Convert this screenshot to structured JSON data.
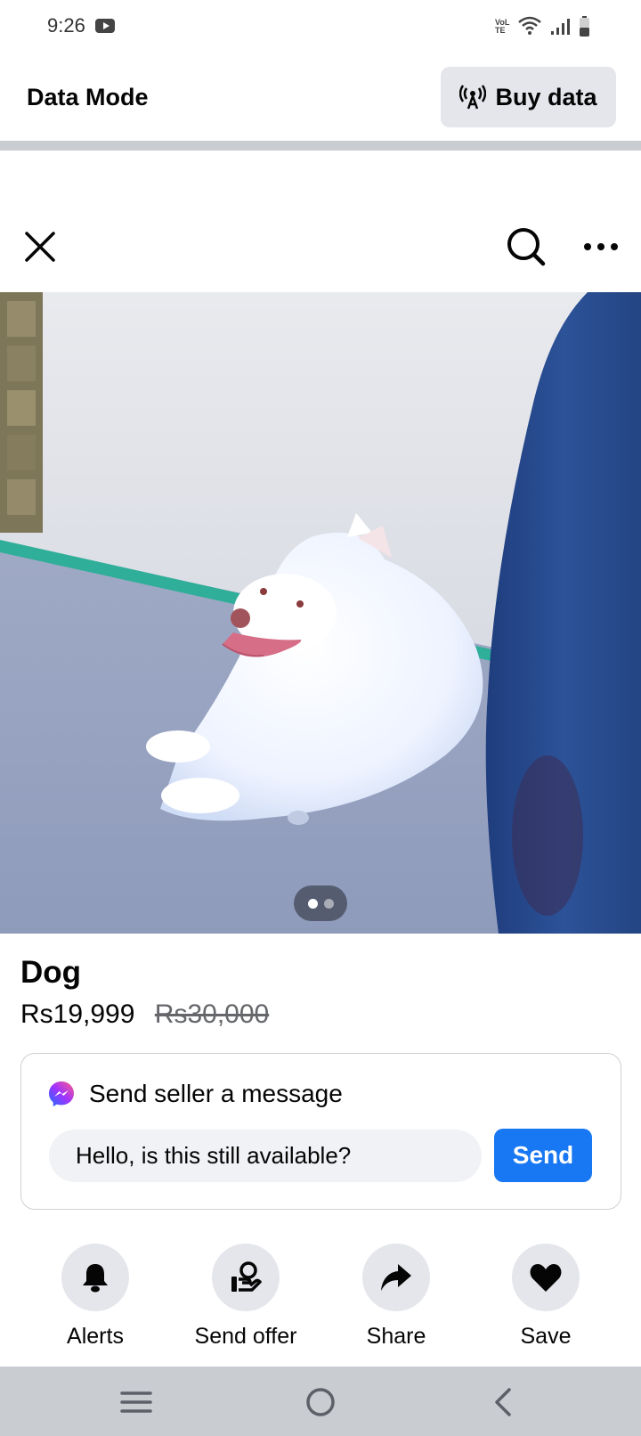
{
  "status_bar": {
    "time": "9:26",
    "network_label": "VoLTE"
  },
  "data_mode": {
    "label": "Data Mode",
    "buy_label": "Buy data"
  },
  "listing": {
    "title": "Dog",
    "price": "Rs19,999",
    "original_price": "Rs30,000",
    "photo_index": 1,
    "photo_count": 2
  },
  "message": {
    "heading": "Send seller a message",
    "input_value": "Hello, is this still available?",
    "send_label": "Send"
  },
  "actions": [
    {
      "label": "Alerts",
      "icon": "bell-icon"
    },
    {
      "label": "Send offer",
      "icon": "offer-icon"
    },
    {
      "label": "Share",
      "icon": "share-icon"
    },
    {
      "label": "Save",
      "icon": "heart-icon"
    }
  ],
  "colors": {
    "accent": "#1877f2",
    "chip": "#e4e6eb",
    "nav": "#c9ccd1"
  }
}
